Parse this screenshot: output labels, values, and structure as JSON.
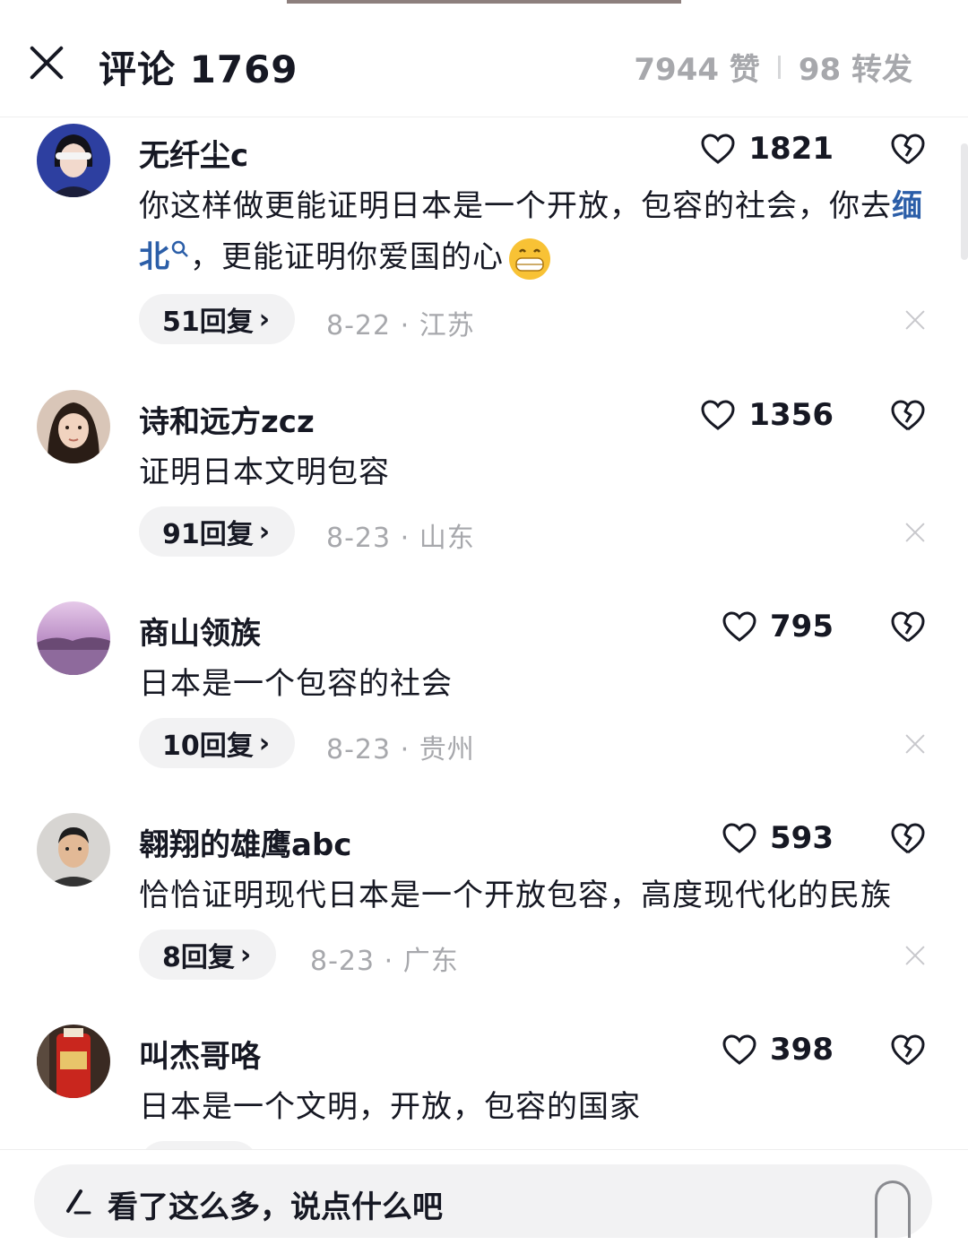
{
  "header": {
    "title": "评论 1769",
    "likes": "7944 赞",
    "shares": "98 转发"
  },
  "comments": [
    {
      "username": "无纤尘c",
      "likes": "1821",
      "text_before": "你这样做更能证明日本是一个开放，包容的社会，你去",
      "text_link": "缅北",
      "text_after": "，更能证明你爱国的心",
      "replies": "51回复",
      "meta": "8-22 · 江苏"
    },
    {
      "username": "诗和远方zcz",
      "likes": "1356",
      "text": "证明日本文明包容",
      "replies": "91回复",
      "meta": "8-23 · 山东"
    },
    {
      "username": "商山领族",
      "likes": "795",
      "text": "日本是一个包容的社会",
      "replies": "10回复",
      "meta": "8-23 · 贵州"
    },
    {
      "username": "翱翔的雄鹰abc",
      "likes": "593",
      "text": "恰恰证明现代日本是一个开放包容，高度现代化的民族",
      "replies": "8回复",
      "meta": "8-23 · 广东"
    },
    {
      "username": "叫杰哥咯",
      "likes": "398",
      "text": "日本是一个文明，开放，包容的国家"
    }
  ],
  "input": {
    "placeholder": "看了这么多，说点什么吧"
  },
  "icons": {
    "close": "close-icon",
    "like": "heart-icon",
    "dislike": "broken-heart-icon",
    "search": "search-icon",
    "reply_arrow": "chevron-right-icon",
    "remove": "close-small-icon",
    "pen": "pen-icon",
    "emoji": "grinning-emoji-icon"
  },
  "colors": {
    "link": "#2b5ea8",
    "muted": "#a7a8ac",
    "text": "#161823",
    "chip_bg": "#f2f2f3"
  }
}
